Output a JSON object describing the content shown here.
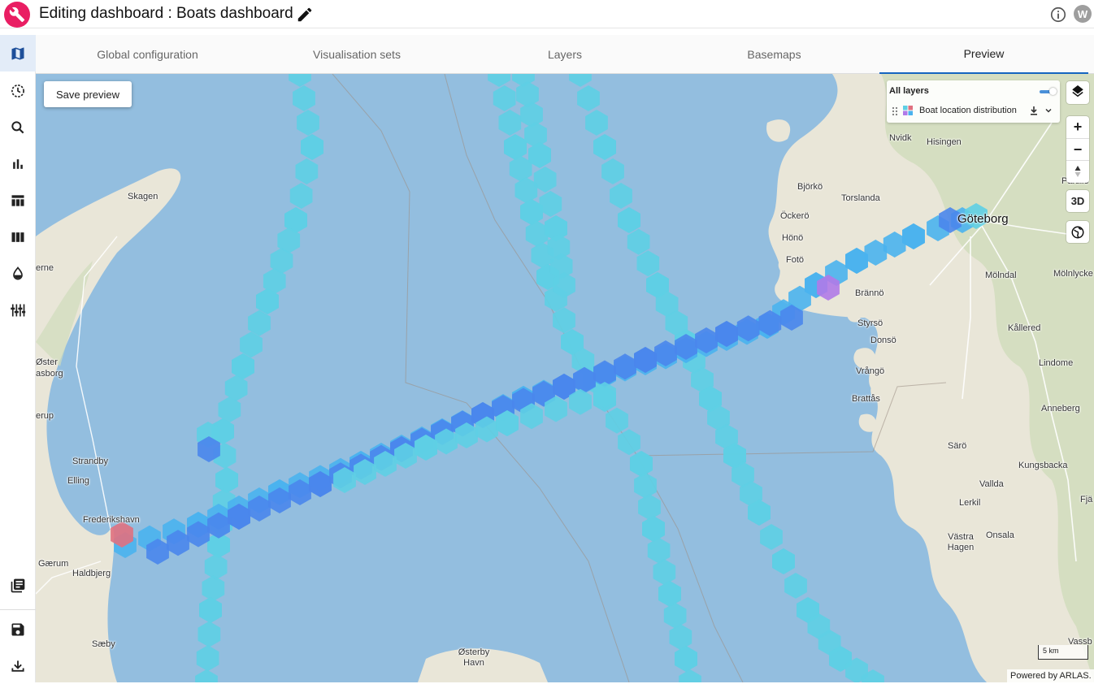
{
  "header": {
    "title": "Editing dashboard : Boats dashboard",
    "avatar_initial": "W"
  },
  "tabs": [
    {
      "label": "Global configuration"
    },
    {
      "label": "Visualisation sets"
    },
    {
      "label": "Layers"
    },
    {
      "label": "Basemaps"
    },
    {
      "label": "Preview",
      "active": true
    }
  ],
  "map": {
    "save_preview_label": "Save preview",
    "layers_panel": {
      "title": "All layers",
      "layer_name": "Boat location distribution",
      "toggle_on": true
    },
    "controls": {
      "zoom_in": "+",
      "zoom_out": "−",
      "mode_3d": "3D"
    },
    "scale_label": "5 km",
    "attribution": "Powered by ARLAS.",
    "hex_colors": {
      "low": "#5ecfe4",
      "medium": "#4ab2ee",
      "high": "#4a86ec",
      "very_high": "#b07ae8",
      "max": "#e0707f"
    },
    "places": [
      {
        "name": "Skagen"
      },
      {
        "name": "Nvidk"
      },
      {
        "name": "Hisingen"
      },
      {
        "name": "Björkö"
      },
      {
        "name": "Torslanda"
      },
      {
        "name": "Öckerö"
      },
      {
        "name": "Hönö"
      },
      {
        "name": "Fotö"
      },
      {
        "name": "Göteborg"
      },
      {
        "name": "Mölndal"
      },
      {
        "name": "Mölnlycke"
      },
      {
        "name": "Brännö"
      },
      {
        "name": "Styrsö"
      },
      {
        "name": "Donsö"
      },
      {
        "name": "Kållered"
      },
      {
        "name": "Vrångö"
      },
      {
        "name": "Lindome"
      },
      {
        "name": "Brattås"
      },
      {
        "name": "Anneberg"
      },
      {
        "name": "Särö"
      },
      {
        "name": "Kungsbacka"
      },
      {
        "name": "Vallda"
      },
      {
        "name": "Lerkil"
      },
      {
        "name": "Onsala"
      },
      {
        "name": "Västra Hagen"
      },
      {
        "name": "Vassb"
      },
      {
        "name": "Fjä"
      },
      {
        "name": "Partille"
      },
      {
        "name": "erne"
      },
      {
        "name": "Øster"
      },
      {
        "name": "asborg"
      },
      {
        "name": "erup"
      },
      {
        "name": "Strandby"
      },
      {
        "name": "Elling"
      },
      {
        "name": "Frederikshavn"
      },
      {
        "name": "Gærum"
      },
      {
        "name": "Haldbjerg"
      },
      {
        "name": "Sæby"
      },
      {
        "name": "Østerby Havn"
      }
    ]
  },
  "sidebar": {
    "items": [
      {
        "icon": "map-icon",
        "active": true
      },
      {
        "icon": "timeline-icon"
      },
      {
        "icon": "search-icon"
      },
      {
        "icon": "bar-chart-icon"
      },
      {
        "icon": "table-icon"
      },
      {
        "icon": "columns-icon"
      },
      {
        "icon": "drop-icon"
      },
      {
        "icon": "sliders-icon"
      },
      {
        "icon": "library-icon"
      },
      {
        "icon": "save-icon"
      },
      {
        "icon": "download-icon"
      }
    ]
  }
}
